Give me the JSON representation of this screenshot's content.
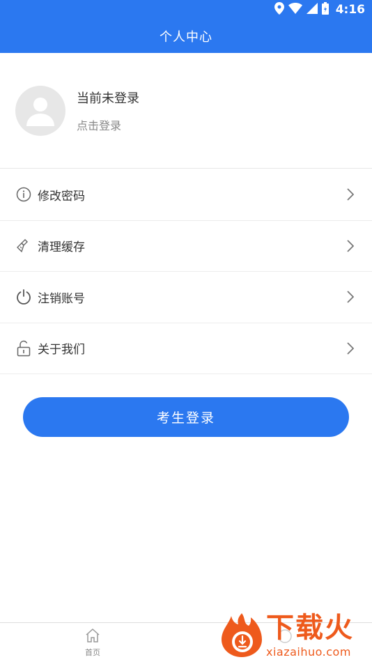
{
  "status_bar": {
    "time": "4:16"
  },
  "header": {
    "title": "个人中心"
  },
  "profile": {
    "name": "当前未登录",
    "action": "点击登录"
  },
  "menu": {
    "items": [
      {
        "label": "修改密码",
        "icon": "info-icon"
      },
      {
        "label": "清理缓存",
        "icon": "brush-icon"
      },
      {
        "label": "注销账号",
        "icon": "power-icon"
      },
      {
        "label": "关于我们",
        "icon": "unlock-icon"
      }
    ]
  },
  "login_button": {
    "label": "考生登录"
  },
  "tabbar": {
    "items": [
      {
        "label": "首页",
        "icon": "home-icon"
      }
    ]
  },
  "watermark": {
    "brand": "下载火",
    "url": "xiazaihuo.com"
  },
  "colors": {
    "primary": "#2b78f0",
    "watermark": "#ee5a1c"
  }
}
